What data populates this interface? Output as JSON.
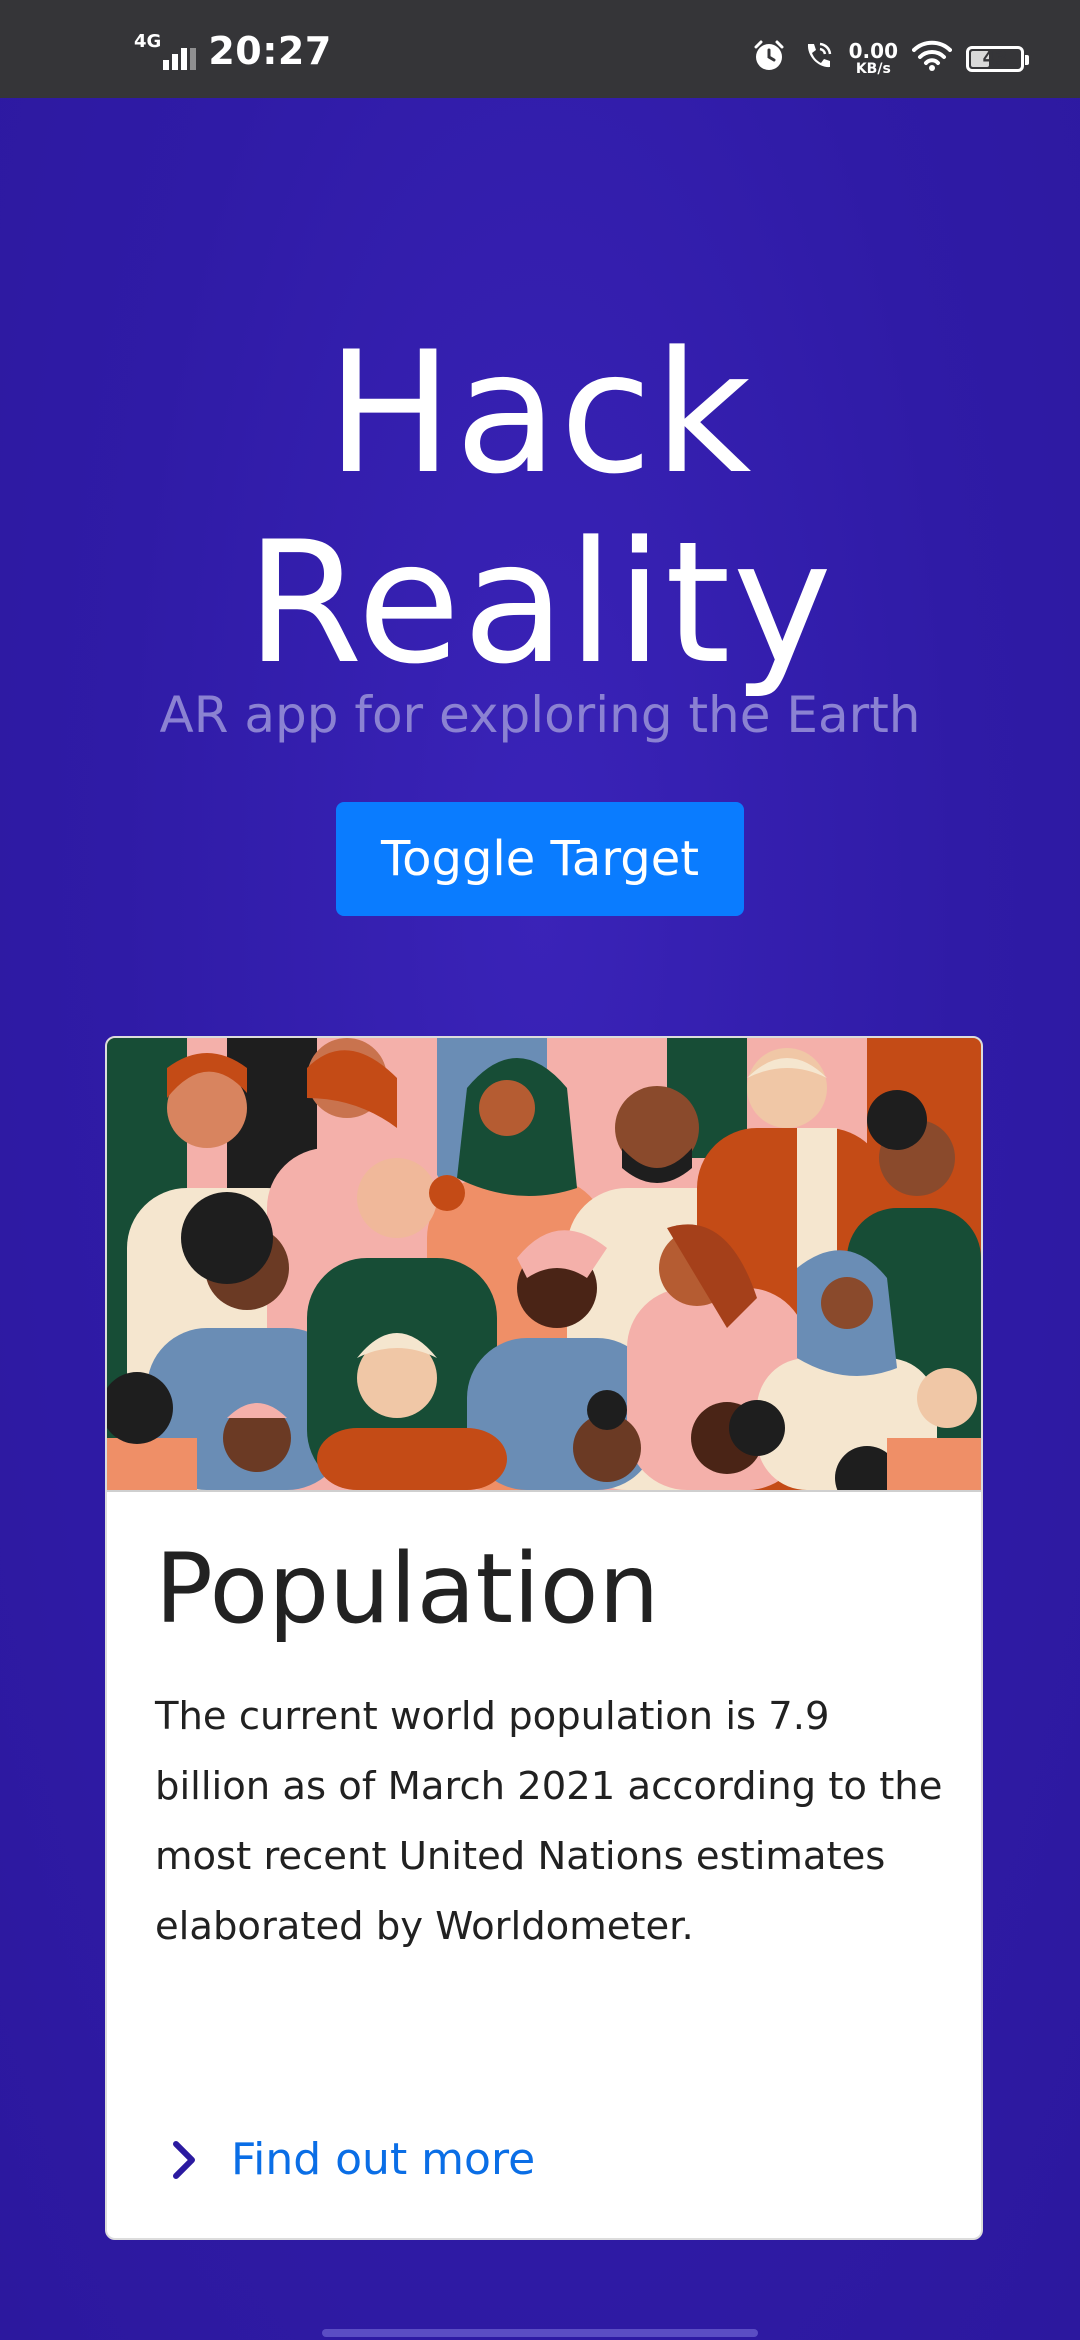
{
  "status_bar": {
    "network": "4G",
    "time": "20:27",
    "data_speed_value": "0.00",
    "data_speed_unit": "KB/s",
    "battery_level": "43",
    "icons": [
      "signal-icon",
      "alarm-icon",
      "wifi-call-icon",
      "wifi-icon",
      "battery-icon"
    ]
  },
  "hero": {
    "title_line1": "Hack",
    "title_line2": "Reality",
    "subtitle": "AR app for exploring the Earth",
    "toggle_label": "Toggle Target"
  },
  "card": {
    "image_description_icon": "people-crowd-illustration",
    "title": "Population",
    "text": "The current world population is 7.9 billion as of March 2021 according to the most recent United Nations estimates elaborated by Worldometer.",
    "link_label": "Find out more",
    "link_icon": "chevron-right-icon"
  },
  "colors": {
    "background": "#2f1ba6",
    "button": "#0a7cff",
    "link": "#0a6ee6",
    "subtitle": "#8b82d2"
  }
}
